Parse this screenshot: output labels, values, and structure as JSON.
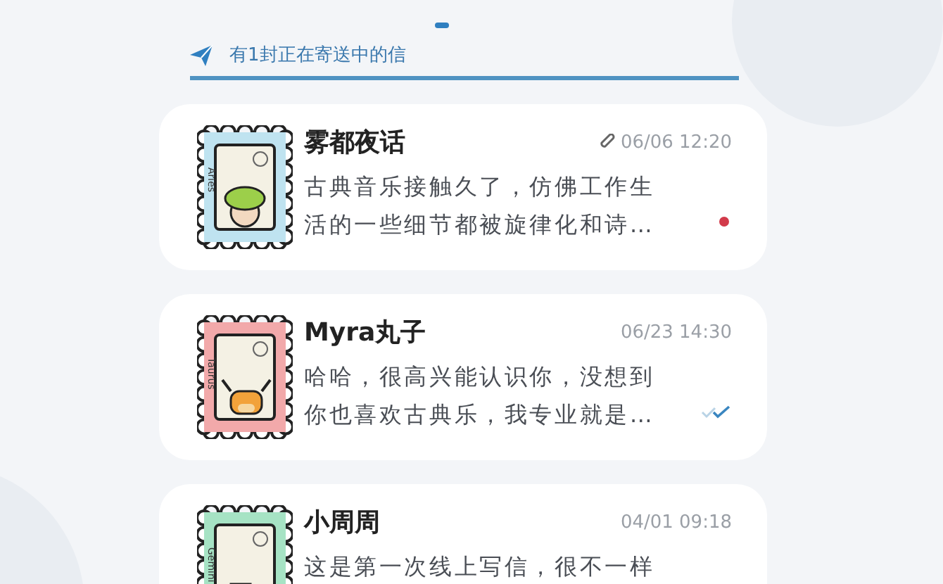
{
  "tabs": [
    {
      "selected": true
    }
  ],
  "sending_banner": {
    "text": "有1封正在寄送中的信"
  },
  "letters": [
    {
      "sender": "雾都夜话",
      "time": "06/06 12:20",
      "attachment": true,
      "preview": "古典音乐接触久了，仿佛工作生活的一些细节都被旋律化和诗…",
      "unread": true,
      "read": false,
      "stamp": {
        "label": "Aries",
        "color": "#bfe3f0",
        "kind": "sheep"
      }
    },
    {
      "sender": "Myra丸子",
      "time": "06/23 14:30",
      "attachment": false,
      "preview": "哈哈，很高兴能认识你，没想到你也喜欢古典乐，我专业就是…",
      "unread": false,
      "read": true,
      "stamp": {
        "label": "Taurus",
        "color": "#f2a9aa",
        "kind": "cow"
      }
    },
    {
      "sender": "小周周",
      "time": "04/01 09:18",
      "attachment": false,
      "preview": "这是第一次线上写信，很不一样",
      "unread": false,
      "read": false,
      "stamp": {
        "label": "Gemini",
        "color": "#a6e3c4",
        "kind": "twins"
      }
    }
  ]
}
